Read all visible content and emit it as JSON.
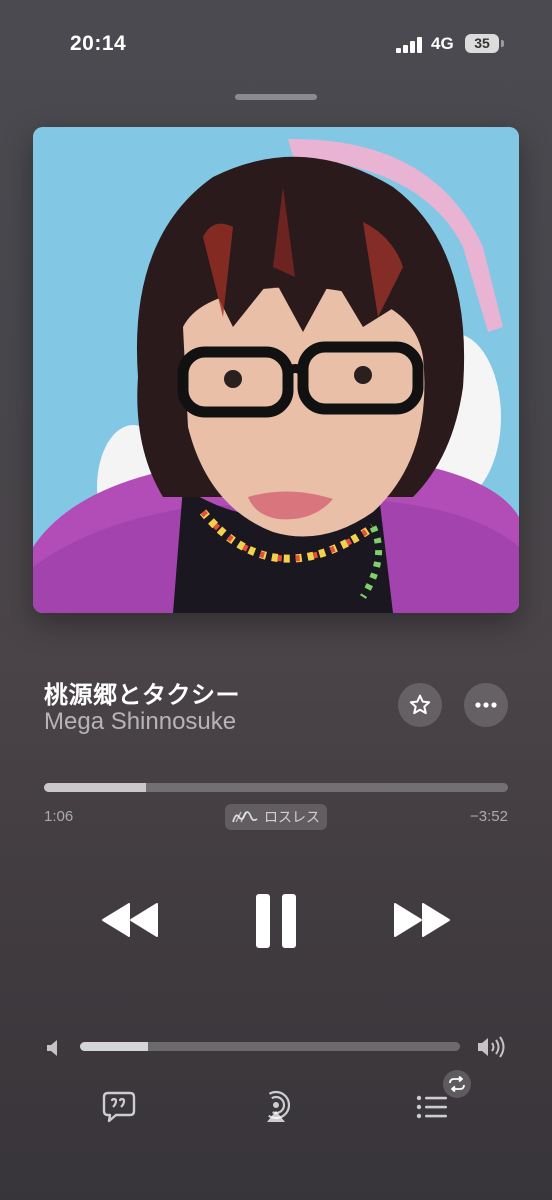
{
  "status": {
    "time": "20:14",
    "network": "4G",
    "battery": "35"
  },
  "track": {
    "title": "桃源郷とタクシー",
    "artist": "Mega Shinnosuke"
  },
  "playback": {
    "elapsed": "1:06",
    "remaining": "−3:52",
    "progress_fraction": 0.22,
    "badge": "ロスレス"
  },
  "volume": {
    "level_fraction": 0.18
  },
  "icons": {
    "grabber": "grabber-handle",
    "star": "star-icon",
    "more": "ellipsis-icon",
    "lossless": "lossless-wave-icon",
    "rewind": "backward-icon",
    "pause": "pause-icon",
    "forward": "forward-icon",
    "volume_min": "speaker-icon",
    "volume_max": "speaker-wave-icon",
    "lyrics": "lyrics-bubble-icon",
    "airplay": "airplay-icon",
    "queue": "list-icon",
    "repeat": "repeat-icon"
  },
  "colors": {
    "artwork_bg": "#82c7e4",
    "hoodie": "#b24db8"
  }
}
